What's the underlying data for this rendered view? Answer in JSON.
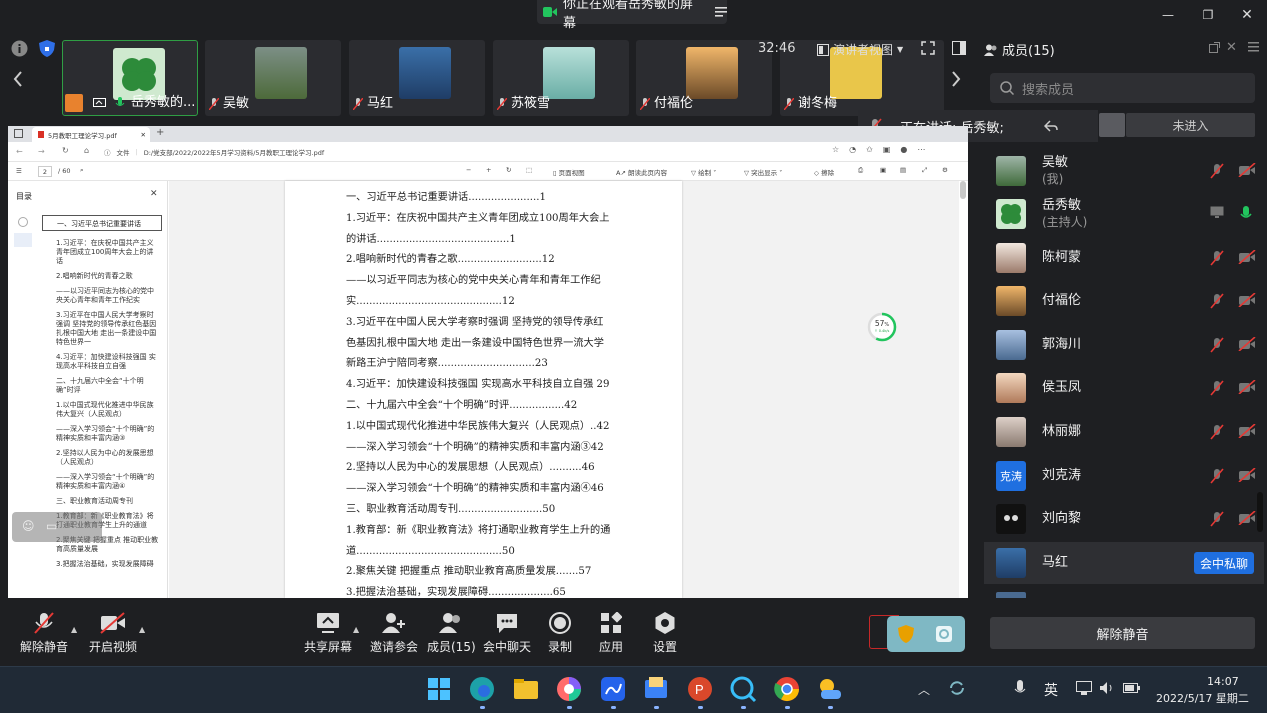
{
  "topbar": {
    "banner_text": "你正在观看岳秀敏的屏幕",
    "minimize_label": "—",
    "restore_label": "❐",
    "close_label": "✕"
  },
  "meeting": {
    "timer": "32:46",
    "view_label": "演讲者视图",
    "members_title": "成员(15)"
  },
  "thumbnails": [
    {
      "name": "岳秀敏的...",
      "color": "#2d8b3a"
    },
    {
      "name": "吴敏",
      "color": "#5a7a4a"
    },
    {
      "name": "马红",
      "color": "#3a6fa8"
    },
    {
      "name": "苏筱雪",
      "color": "#8cc6c0"
    },
    {
      "name": "付福伦",
      "color": "#c08848"
    },
    {
      "name": "谢冬梅",
      "color": "#e9c64a"
    }
  ],
  "panel": {
    "search_placeholder": "搜索成员",
    "speaking_text": "正在讲话: 岳秀敏;",
    "not_entered_label": "未进入",
    "unmute_all_label": "解除静音",
    "private_chat_label": "会中私聊",
    "members": [
      {
        "name": "吴敏",
        "sub": "(我)",
        "color": "#6a8f6a"
      },
      {
        "name": "岳秀敏",
        "sub": "(主持人)",
        "color": "#2d8b3a"
      },
      {
        "name": "陈柯蒙",
        "sub": "",
        "color": "#d9c2b2"
      },
      {
        "name": "付福伦",
        "sub": "",
        "color": "#c08848"
      },
      {
        "name": "郭海川",
        "sub": "",
        "color": "#7a8fb0"
      },
      {
        "name": "侯玉凤",
        "sub": "",
        "color": "#d8a88a"
      },
      {
        "name": "林丽娜",
        "sub": "",
        "color": "#b8a8a0"
      },
      {
        "name": "刘克涛",
        "sub": "",
        "avatar_text": "克涛",
        "color": "#1f6fe0"
      },
      {
        "name": "刘向黎",
        "sub": "",
        "color": "#1a1a1a"
      },
      {
        "name": "马红",
        "sub": "",
        "color": "#3a6fa8"
      }
    ]
  },
  "toolbar": {
    "unmute": "解除静音",
    "start_video": "开启视频",
    "share_screen": "共享屏幕",
    "invite": "邀请参会",
    "members": "成员(15)",
    "chat": "会中聊天",
    "record": "录制",
    "apps": "应用",
    "settings": "设置"
  },
  "browser": {
    "tab_title": "5月教职工理论学习.pdf",
    "address": "D:/党支部/2022/2022年5月学习资料/5月教职工理论学习.pdf",
    "file_label": "文件",
    "page_current": "2",
    "page_total": "/ 60",
    "page_view": "页面视图",
    "read_aloud": "朗读此页内容",
    "draw": "绘制",
    "highlight": "突出显示",
    "erase": "擦除",
    "toc_title": "目录",
    "progress_value": "57",
    "progress_unit": "%",
    "progress_speed": "↑ 0.4k/s"
  },
  "toc": [
    "一、习近平总书记重要讲话",
    "1.习近平：在庆祝中国共产主义青年团成立100周年大会上的讲话",
    "2.唱响新时代的青春之歌",
    "——以习近平同志为核心的党中央关心青年和青年工作纪实",
    "3.习近平在中国人民大学考察时强调 坚持党的领导传承红色基因扎根中国大地 走出一条建设中国特色世界一",
    "4.习近平：加快建设科技强国 实现高水平科技自立自强",
    "二、十九届六中全会“十个明确”时评",
    "1.以中国式现代化推进中华民族伟大复兴（人民观点）",
    "——深入学习领会“十个明确”的精神实质和丰富内涵③",
    "2.坚持以人民为中心的发展思想（人民观点）",
    "——深入学习领会“十个明确”的精神实质和丰富内涵④",
    "三、职业教育活动周专刊",
    "1.教育部：新《职业教育法》将打通职业教育学生上升的通道",
    "2.聚焦关键 把握重点 推动职业教育高质量发展",
    "3.把握法治基础，实现发展障碍"
  ],
  "doc_lines": [
    "一、习近平总书记重要讲话......................1",
    "1.习近平：在庆祝中国共产主义青年团成立100周年大会上",
    "的讲话.........................................1",
    "2.唱响新时代的青春之歌..........................12",
    "——以习近平同志为核心的党中央关心青年和青年工作纪",
    "实.............................................12",
    "3.习近平在中国人民大学考察时强调 坚持党的领导传承红",
    "色基因扎根中国大地 走出一条建设中国特色世界一流大学",
    "新路王沪宁陪同考察..............................23",
    "4.习近平：加快建设科技强国 实现高水平科技自立自强 29",
    "二、十九届六中全会“十个明确”时评.................42",
    "1.以中国式现代化推进中华民族伟大复兴（人民观点）..42",
    "——深入学习领会“十个明确”的精神实质和丰富内涵③42",
    "2.坚持以人民为中心的发展思想（人民观点）..........46",
    "——深入学习领会“十个明确”的精神实质和丰富内涵④46",
    "三、职业教育活动周专刊..........................50",
    "1.教育部：新《职业教育法》将打通职业教育学生上升的通",
    "道.............................................50",
    "2.聚焦关键 把握重点 推动职业教育高质量发展.......57",
    "3.把握法治基础，实现发展障碍....................65"
  ],
  "taskbar": {
    "ime": "英",
    "time": "14:07",
    "date": "2022/5/17 星期二"
  }
}
